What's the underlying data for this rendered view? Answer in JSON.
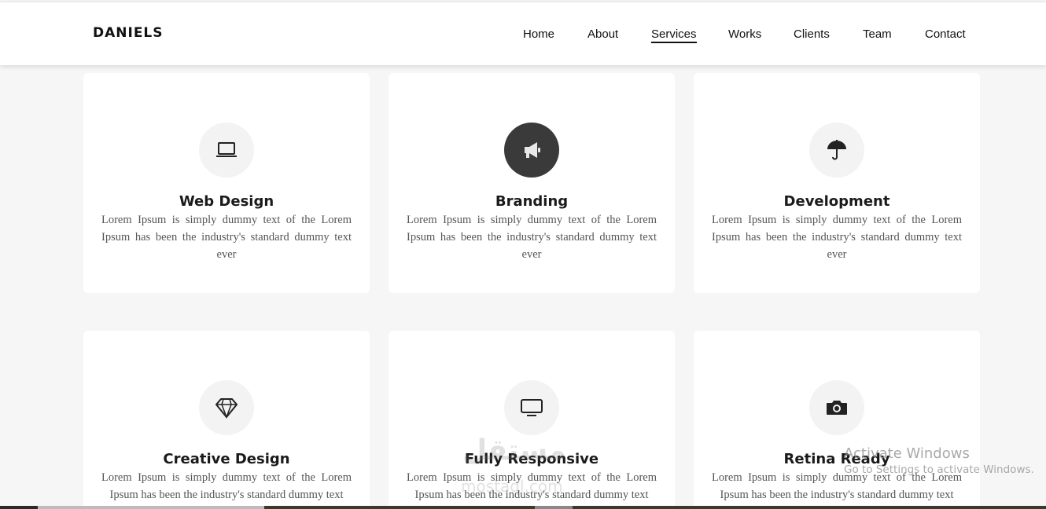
{
  "brand": "DANIELS",
  "nav": {
    "items": [
      {
        "label": "Home"
      },
      {
        "label": "About"
      },
      {
        "label": "Services"
      },
      {
        "label": "Works"
      },
      {
        "label": "Clients"
      },
      {
        "label": "Team"
      },
      {
        "label": "Contact"
      }
    ],
    "active": "Services"
  },
  "services": [
    {
      "title": "Web Design",
      "icon": "laptop-icon",
      "text": "Lorem Ipsum is simply dummy text of the Lorem Ipsum has been the industry's standard dummy text ever"
    },
    {
      "title": "Branding",
      "icon": "megaphone-icon",
      "text": "Lorem Ipsum is simply dummy text of the Lorem Ipsum has been the industry's standard dummy text ever"
    },
    {
      "title": "Development",
      "icon": "umbrella-icon",
      "text": "Lorem Ipsum is simply dummy text of the Lorem Ipsum has been the industry's standard dummy text ever"
    },
    {
      "title": "Creative Design",
      "icon": "diamond-icon",
      "text": "Lorem Ipsum is simply dummy text of the Lorem Ipsum has been the industry's standard dummy text"
    },
    {
      "title": "Fully Responsive",
      "icon": "monitor-icon",
      "text": "Lorem Ipsum is simply dummy text of the Lorem Ipsum has been the industry's standard dummy text"
    },
    {
      "title": "Retina Ready",
      "icon": "camera-icon",
      "text": "Lorem Ipsum is simply dummy text of the Lorem Ipsum has been the industry's standard dummy text"
    }
  ],
  "watermark": {
    "arabic": "مستقل",
    "latin": "mostaql.com"
  },
  "os_notice": {
    "title": "Activate Windows",
    "subtitle": "Go to Settings to activate Windows."
  },
  "colors": {
    "text": "#111111",
    "background": "#f6f6f6",
    "card": "#ffffff",
    "icon_active": "#3a3a3a"
  }
}
